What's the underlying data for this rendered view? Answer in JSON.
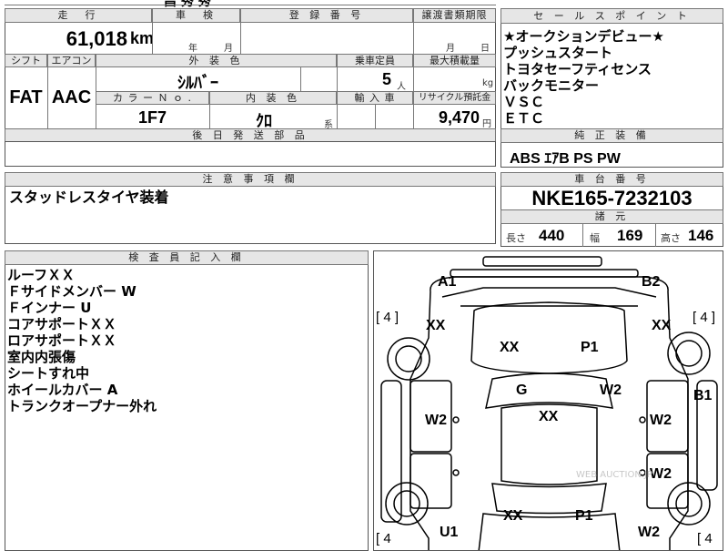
{
  "top_fragment": "昌 秀 秀",
  "vehicle": {
    "mileage_header": "走　行",
    "mileage_value": "61,018",
    "mileage_unit": "km",
    "inspection_header": "車　検",
    "inspection_year_unit": "年",
    "inspection_month_unit": "月",
    "registration_header": "登 録 番 号",
    "transfer_header": "譲渡書類期限",
    "transfer_month_unit": "月",
    "transfer_day_unit": "日",
    "shift_header": "シフト",
    "shift_value": "FAT",
    "ac_header": "エアコン",
    "ac_value": "AAC",
    "exterior_color_header": "外 装 色",
    "exterior_color_value": "ｼﾙﾊﾞｰ",
    "capacity_header": "乗車定員",
    "capacity_value": "5",
    "capacity_unit": "人",
    "max_load_header": "最大積載量",
    "max_load_unit": "kg",
    "color_no_header": "カ ラ ー Ｎ ｏ .",
    "color_no_value": "1F7",
    "interior_color_header": "内 装 色",
    "interior_color_value": "ｸﾛ",
    "interior_color_suffix": "系",
    "import_header": "輸 入 車",
    "recycle_header": "リサイクル預託金",
    "recycle_value": "9,470",
    "recycle_unit": "円",
    "later_parts_header": "後 日 発 送 部 品"
  },
  "selling_points": {
    "header": "セ ー ル ス ポ イ ン ト",
    "items": [
      "★オークションデビュー★",
      "プッシュスタート",
      "トヨタセーフティセンス",
      "バックモニター",
      "ＶＳＣ",
      "ＥＴＣ"
    ]
  },
  "genuine_equipment": {
    "header": "純 正 装 備",
    "value": "ABS ｴｱB PS PW"
  },
  "notes": {
    "header": "注 意 事 項 欄",
    "value": "スタッドレスタイヤ装着"
  },
  "chassis": {
    "header": "車 台 番 号",
    "value": "NKE165-7232103",
    "dimensions_header": "諸 元",
    "length_label": "長さ",
    "length_value": "440",
    "width_label": "幅",
    "width_value": "169",
    "height_label": "高さ",
    "height_value": "146"
  },
  "inspector": {
    "header": "検 査 員 記 入 欄",
    "lines": [
      "ルーフＸＸ",
      "Ｆサイドメンバー W",
      "Ｆインナー U",
      "コアサポートＸＸ",
      "ロアサポートＸＸ",
      "室内内張傷",
      "シートすれ中",
      "ホイールカバー A",
      "トランクオープナー外れ"
    ]
  },
  "diagram": {
    "tire_fl": "[ 4 ]",
    "tire_fr": "[ 4 ]",
    "tire_rl": "[ 4",
    "tire_rr": "[ 4",
    "a1": "A1",
    "b2": "B2",
    "xx_left_front": "XX",
    "xx_right_front": "XX",
    "xx_hood": "XX",
    "p1_hood": "P1",
    "g": "G",
    "w2_windshield": "W2",
    "b1": "B1",
    "w2_left": "W2",
    "xx_roof": "XX",
    "w2_right": "W2",
    "w2_right_rear": "W2",
    "xx_trunk": "XX",
    "p1_trunk": "P1",
    "u1": "U1",
    "w2_rear": "W2",
    "watermark": "WEB AUCTION.JP"
  }
}
